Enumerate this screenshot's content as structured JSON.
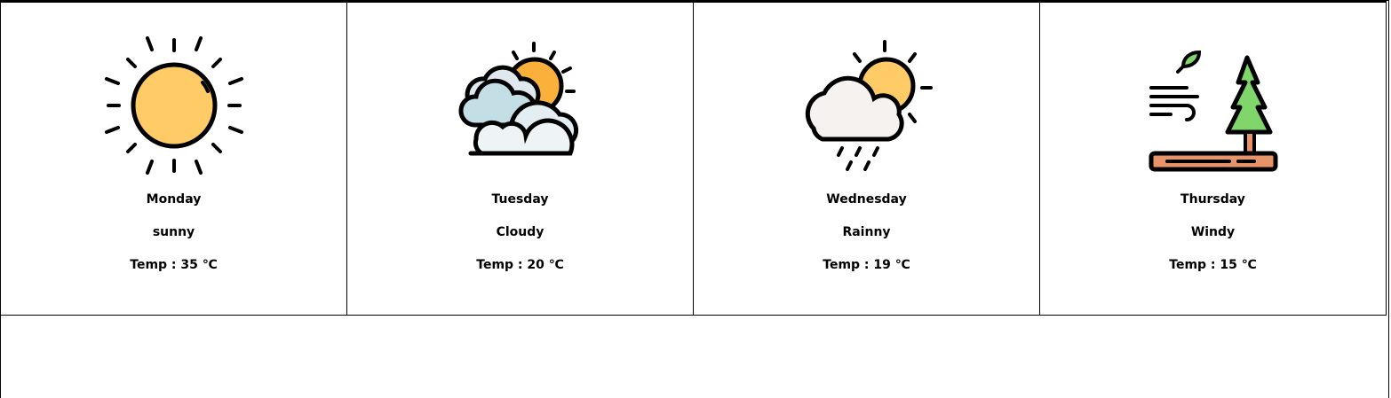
{
  "forecast": [
    {
      "day": "Monday",
      "condition": "sunny",
      "temp_label": "Temp",
      "temp_value": "35",
      "unit": "℃",
      "icon": "sun-icon"
    },
    {
      "day": "Tuesday",
      "condition": "Cloudy",
      "temp_label": "Temp",
      "temp_value": "20",
      "unit": "℃",
      "icon": "cloudy-icon"
    },
    {
      "day": "Wednesday",
      "condition": "Rainny",
      "temp_label": "Temp",
      "temp_value": "19",
      "unit": "℃",
      "icon": "rain-icon"
    },
    {
      "day": "Thursday",
      "condition": "Windy",
      "temp_label": "Temp",
      "temp_value": "15",
      "unit": "℃",
      "icon": "wind-icon"
    }
  ],
  "temp_text": [
    "Temp : 35 ℃",
    "Temp : 20 ℃",
    "Temp : 19 ℃",
    "Temp : 15 ℃"
  ]
}
